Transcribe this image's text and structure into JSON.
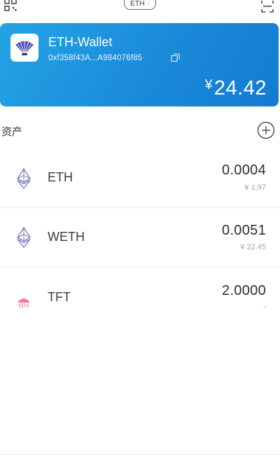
{
  "topbar": {
    "left_icon": "qr-code-icon",
    "network_label": "ETH ·",
    "right_icon": "scan-icon"
  },
  "wallet": {
    "name": "ETH-Wallet",
    "address": "0xf358f43A...A984076f85",
    "currency_symbol": "¥",
    "balance": "24.42",
    "logo_icon": "shell-logo-icon",
    "copy_icon": "copy-icon",
    "accent_colors": [
      "#23a4e6",
      "#147bd1"
    ]
  },
  "assets": {
    "title": "资产",
    "add_icon": "plus-circle-icon",
    "items": [
      {
        "symbol": "ETH",
        "amount": "0.0004",
        "fiat": "¥ 1.97",
        "icon": "ethereum-icon"
      },
      {
        "symbol": "WETH",
        "amount": "0.0051",
        "fiat": "¥ 22.45",
        "icon": "ethereum-icon"
      },
      {
        "symbol": "TFT",
        "amount": "2.0000",
        "fiat": "-",
        "icon": "tft-token-icon"
      }
    ]
  }
}
